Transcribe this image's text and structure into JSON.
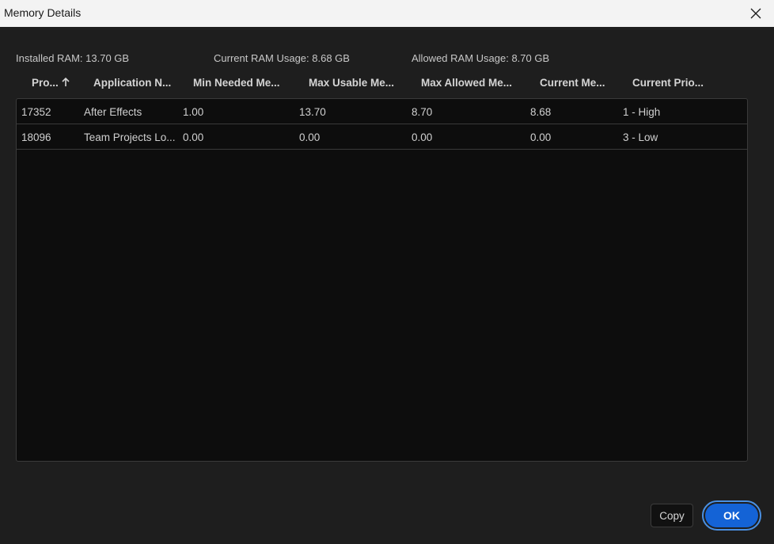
{
  "window": {
    "title": "Memory Details"
  },
  "stats": {
    "installed": "Installed RAM: 13.70 GB",
    "current": "Current RAM Usage: 8.68 GB",
    "allowed": "Allowed RAM Usage: 8.70 GB"
  },
  "columns": [
    "Pro...",
    "Application N...",
    "Min Needed Me...",
    "Max Usable Me...",
    "Max Allowed Me...",
    "Current Me...",
    "Current Prio..."
  ],
  "rows": [
    [
      "17352",
      "After Effects",
      "1.00",
      "13.70",
      "8.70",
      "8.68",
      "1 - High"
    ],
    [
      "18096",
      "Team Projects Lo...",
      "0.00",
      "0.00",
      "0.00",
      "0.00",
      "3 - Low"
    ]
  ],
  "buttons": {
    "copy": "Copy",
    "ok": "OK"
  },
  "colors": {
    "accent": "#1463d6",
    "table_bg": "#0d0d0d",
    "dialog_bg": "#1e1e1e"
  },
  "icons": {
    "close": "close-icon",
    "sort": "sort-ascending-icon"
  }
}
